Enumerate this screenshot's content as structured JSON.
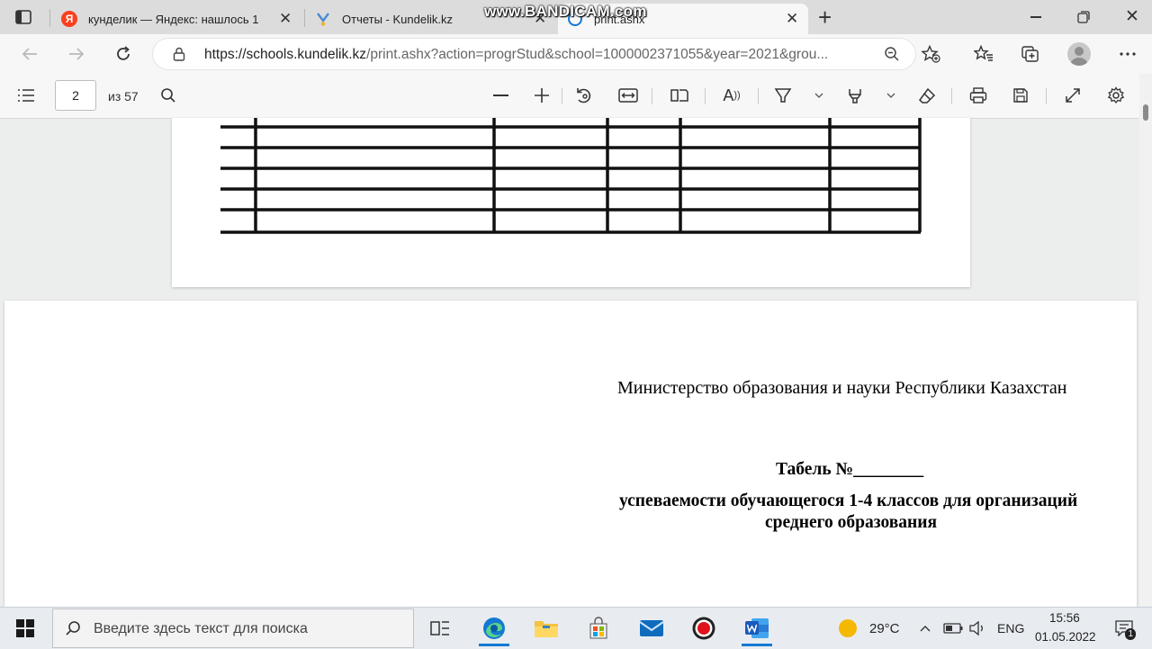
{
  "browser": {
    "tabs": [
      {
        "title": "кунделик — Яндекс: нашлось 1"
      },
      {
        "title": "Отчеты - Kundelik.kz"
      },
      {
        "title": "print.ashx"
      }
    ],
    "new_tab_symbol": "+",
    "close_symbol": "✕",
    "url_host": "https://schools.kundelik.kz",
    "url_path": "/print.ashx?action=progrStud&school=1000002371055&year=2021&grou..."
  },
  "watermark": "www.BANDICAM.com",
  "pdf_toolbar": {
    "page_number": "2",
    "page_total": "из 57"
  },
  "document": {
    "ministry": "Министерство образования и науки Республики Казахстан",
    "title": "Табель №________",
    "subtitle_line1": "успеваемости обучающегося 1-4 классов для организаций",
    "subtitle_line2": "среднего образования"
  },
  "taskbar": {
    "search_placeholder": "Введите здесь текст для поиска",
    "weather": "29°C",
    "language": "ENG",
    "time": "15:56",
    "date": "01.05.2022",
    "notifications": "1"
  },
  "colors": {
    "yandex": "#fc3f1d",
    "edge_blue": "#1379d3",
    "word_blue": "#185abd",
    "record_red": "#e0121b"
  }
}
